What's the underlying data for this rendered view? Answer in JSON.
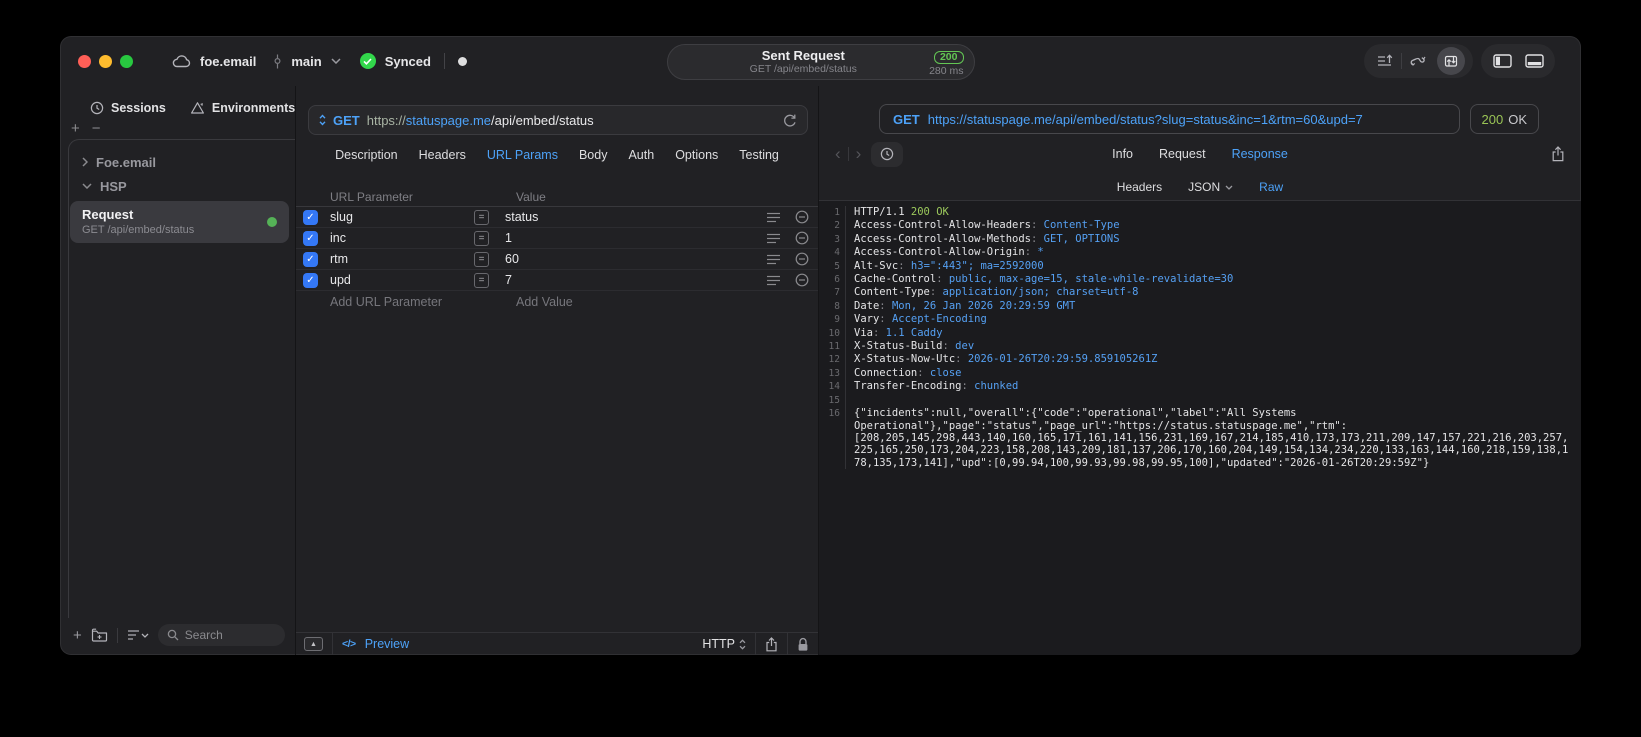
{
  "window": {
    "project": "foe.email",
    "branch": "main",
    "sync_label": "Synced",
    "center": {
      "title": "Sent Request",
      "subtitle": "GET /api/embed/status",
      "status": "200",
      "time": "280 ms"
    }
  },
  "icons": {
    "plus": "+",
    "minus": "−",
    "equals": "=",
    "check": "✓",
    "collapse": "▲",
    "code": "</>",
    "chevron_left": "‹",
    "chevron_right": "›"
  },
  "sidebar": {
    "tabs": [
      {
        "label": "Sessions"
      },
      {
        "label": "Environments"
      }
    ],
    "groups": [
      {
        "label": "Foe.email"
      },
      {
        "label": "HSP"
      }
    ],
    "request": {
      "title": "Request",
      "subtitle": "GET /api/embed/status"
    },
    "search_placeholder": "Search"
  },
  "request_editor": {
    "method": "GET",
    "url_scheme": "https://",
    "url_host": "statuspage.me",
    "url_path": "/api/embed/status",
    "tabs": [
      "Description",
      "Headers",
      "URL Params",
      "Body",
      "Auth",
      "Options",
      "Testing"
    ],
    "params": {
      "col_name": "URL Parameter",
      "col_value": "Value",
      "rows": [
        {
          "name": "slug",
          "value": "status"
        },
        {
          "name": "inc",
          "value": "1"
        },
        {
          "name": "rtm",
          "value": "60"
        },
        {
          "name": "upd",
          "value": "7"
        }
      ],
      "add_name": "Add URL Parameter",
      "add_value": "Add Value"
    },
    "footer": {
      "preview": "Preview",
      "protocol": "HTTP"
    }
  },
  "response_viewer": {
    "method": "GET",
    "url": "https://statuspage.me/api/embed/status?slug=status&inc=1&rtm=60&upd=7",
    "status_code": "200",
    "status_text": "OK",
    "tabs": [
      "Info",
      "Request",
      "Response"
    ],
    "subtabs": [
      "Headers",
      "JSON",
      "Raw"
    ],
    "status_line": {
      "protocol": "HTTP/1.1",
      "status": "200 OK"
    },
    "colon": ": ",
    "headers": [
      {
        "name": "Access-Control-Allow-Headers",
        "value": "Content-Type"
      },
      {
        "name": "Access-Control-Allow-Methods",
        "value": "GET, OPTIONS"
      },
      {
        "name": "Access-Control-Allow-Origin",
        "value": "*"
      },
      {
        "name": "Alt-Svc",
        "value": "h3=\":443\"; ma=2592000"
      },
      {
        "name": "Cache-Control",
        "value": "public, max-age=15, stale-while-revalidate=30"
      },
      {
        "name": "Content-Type",
        "value": "application/json; charset=utf-8"
      },
      {
        "name": "Date",
        "value": "Mon, 26 Jan 2026 20:29:59 GMT"
      },
      {
        "name": "Vary",
        "value": "Accept-Encoding"
      },
      {
        "name": "Via",
        "value": "1.1 Caddy"
      },
      {
        "name": "X-Status-Build",
        "value": "dev"
      },
      {
        "name": "X-Status-Now-Utc",
        "value": "2026-01-26T20:29:59.859105261Z"
      },
      {
        "name": "Connection",
        "value": "close"
      },
      {
        "name": "Transfer-Encoding",
        "value": "chunked"
      }
    ],
    "line_numbers": [
      "1",
      "2",
      "3",
      "4",
      "5",
      "6",
      "7",
      "8",
      "9",
      "10",
      "11",
      "12",
      "13",
      "14",
      "15",
      "16"
    ],
    "body": "{\"incidents\":null,\"overall\":{\"code\":\"operational\",\"label\":\"All Systems Operational\"},\"page\":\"status\",\"page_url\":\"https://status.statuspage.me\",\"rtm\":[208,205,145,298,443,140,160,165,171,161,141,156,231,169,167,214,185,410,173,173,211,209,147,157,221,216,203,257,225,165,250,173,204,223,158,208,143,209,181,137,206,170,160,204,149,154,134,234,220,133,163,144,160,218,159,138,178,135,173,141],\"upd\":[0,99.94,100,99.93,99.98,99.95,100],\"updated\":\"2026-01-26T20:29:59Z\"}"
  }
}
